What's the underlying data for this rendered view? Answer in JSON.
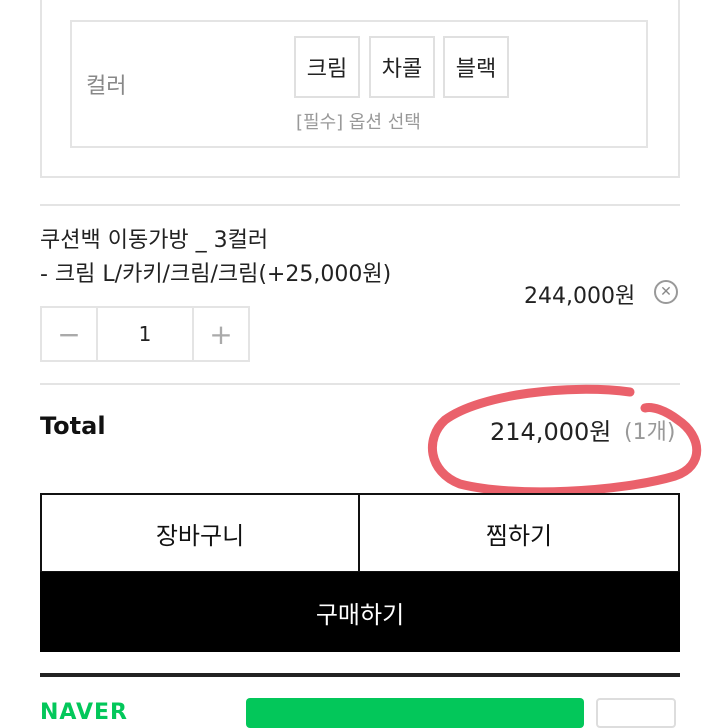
{
  "option": {
    "label": "컬러",
    "choices": [
      "크림",
      "차콜",
      "블랙"
    ],
    "hint": "[필수] 옵션 선택"
  },
  "item": {
    "name": "쿠션백 이동가방 _ 3컬러",
    "option_text": "- 크림 L/카키/크림/크림(+25,000원)",
    "price": "244,000원",
    "quantity": "1",
    "minus_icon": "minus-icon",
    "plus_icon": "plus-icon",
    "remove_icon": "close-circle-icon"
  },
  "total": {
    "label": "Total",
    "price": "214,000원",
    "count": "(1개)"
  },
  "actions": {
    "cart": "장바구니",
    "wish": "찜하기",
    "buy": "구매하기"
  },
  "naver": {
    "logo": "NAVER",
    "brand_color": "#03c75a"
  },
  "annotation_color": "#e8505b"
}
